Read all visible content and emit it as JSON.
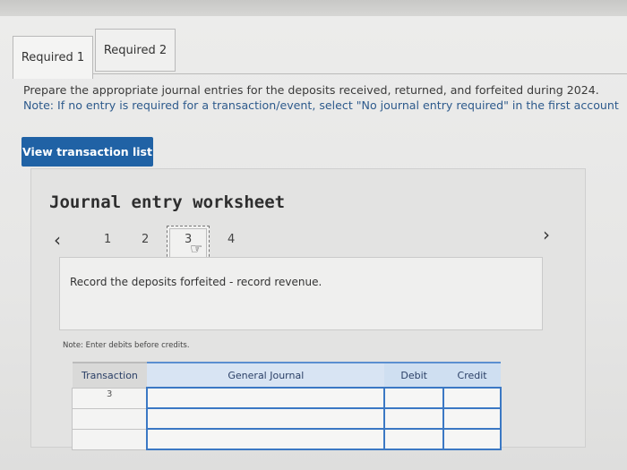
{
  "tabs": [
    {
      "label": "Required 1"
    },
    {
      "label": "Required 2"
    }
  ],
  "instructions": {
    "line1": "Prepare the appropriate journal entries for the deposits received, returned, and forfeited during 2024.",
    "line2": "Note: If no entry is required for a transaction/event, select \"No journal entry required\" in the first account"
  },
  "view_transaction_list_label": "View transaction list",
  "worksheet": {
    "title": "Journal entry worksheet",
    "pages": [
      "1",
      "2",
      "3",
      "4"
    ],
    "current_page": "3",
    "prev_icon": "chevron-left-icon",
    "next_icon": "chevron-right-icon",
    "description": "Record the deposits forfeited - record revenue.",
    "note": "Note: Enter debits before credits."
  },
  "journal_table": {
    "headers": [
      "Transaction",
      "General Journal",
      "Debit",
      "Credit"
    ],
    "rows": [
      {
        "transaction": "3"
      },
      {
        "transaction": ""
      },
      {
        "transaction": ""
      }
    ]
  }
}
